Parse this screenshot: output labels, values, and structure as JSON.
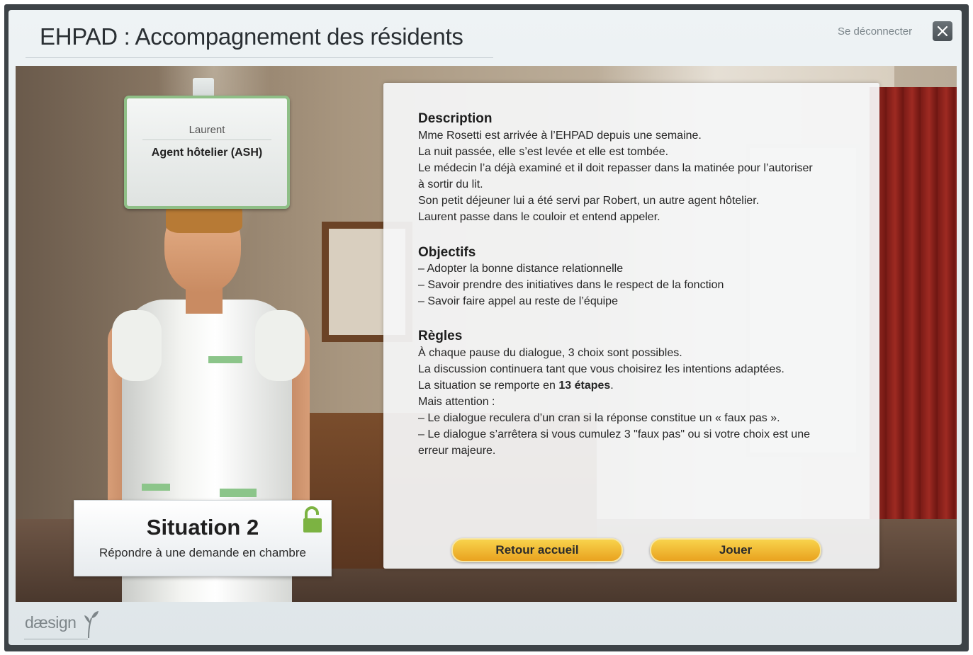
{
  "header": {
    "title": "EHPAD : Accompagnement des résidents",
    "logout_label": "Se déconnecter",
    "close_icon": "close-icon"
  },
  "badge": {
    "name": "Laurent",
    "role": "Agent hôtelier (ASH)"
  },
  "situation": {
    "title": "Situation 2",
    "subtitle": "Répondre à une demande en chambre",
    "lock_icon": "unlocked-padlock-icon",
    "lock_color": "#7cb342"
  },
  "panel": {
    "description_title": "Description",
    "description_lines": [
      "Mme Rosetti est arrivée à l’EHPAD depuis une semaine.",
      "La nuit passée, elle s’est levée et elle est tombée.",
      "Le médecin l’a déjà examiné et il doit repasser dans la matinée pour l’autoriser",
      "à sortir du lit.",
      "Son petit déjeuner lui a été servi par Robert, un autre agent hôtelier.",
      "Laurent passe dans le couloir et entend appeler."
    ],
    "objectifs_title": "Objectifs",
    "objectifs_lines": [
      "– Adopter la bonne distance relationnelle",
      "– Savoir prendre des initiatives dans le respect de la fonction",
      "– Savoir faire appel au reste de l’équipe"
    ],
    "regles_title": "Règles",
    "regles_lines": [
      "À chaque pause du dialogue, 3 choix sont possibles.",
      "La discussion continuera tant que vous choisirez les intentions adaptées."
    ],
    "regles_steps_prefix": "La situation se remporte en ",
    "regles_steps_bold": "13 étapes",
    "regles_steps_suffix": ".",
    "regles_lines_2": [
      "Mais attention :",
      "– Le dialogue reculera d’un cran si la réponse constitue un « faux pas ».",
      "– Le dialogue s’arrêtera si vous cumulez 3 \"faux pas\" ou si votre choix est une",
      "erreur majeure."
    ]
  },
  "buttons": {
    "back_label": "Retour accueil",
    "play_label": "Jouer",
    "accent": "#f0b52e"
  },
  "footer": {
    "logo_text": "dæsign",
    "logo_icon": "sprout-icon"
  }
}
